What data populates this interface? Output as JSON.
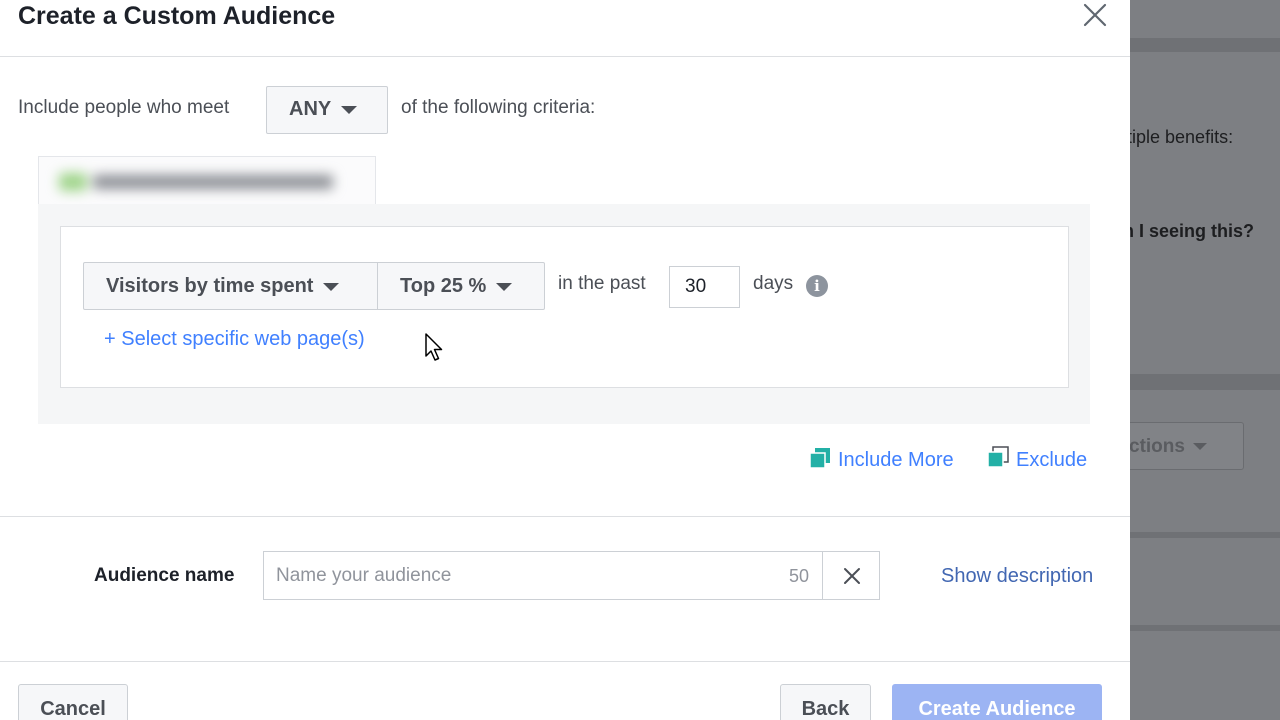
{
  "modal": {
    "title": "Create a Custom Audience",
    "criteria": {
      "prefix": "Include people who meet",
      "match_value": "ANY",
      "suffix": "of the following criteria:"
    },
    "rule": {
      "event_value": "Visitors by time spent",
      "percentile_value": "Top 25 %",
      "in_past_label": "in the past",
      "days_value": "30",
      "days_label": "days",
      "info_glyph": "i",
      "select_pages_link": "+ Select specific web page(s)"
    },
    "actions": {
      "include_more": "Include More",
      "exclude": "Exclude"
    },
    "audience_name": {
      "label": "Audience name",
      "placeholder": "Name your audience",
      "value": "",
      "char_limit": "50",
      "show_description": "Show description"
    },
    "footer": {
      "cancel": "Cancel",
      "back": "Back",
      "create": "Create Audience"
    }
  },
  "background_page": {
    "text_benefits": "ıltiple benefits:",
    "text_seeing": "m I seeing this?",
    "button_label": "ctions"
  },
  "colors": {
    "link": "#4080ff",
    "primary_disabled": "#9cb4f3",
    "include_icon": "#23b0a6",
    "overlay": "#7d7f83"
  }
}
